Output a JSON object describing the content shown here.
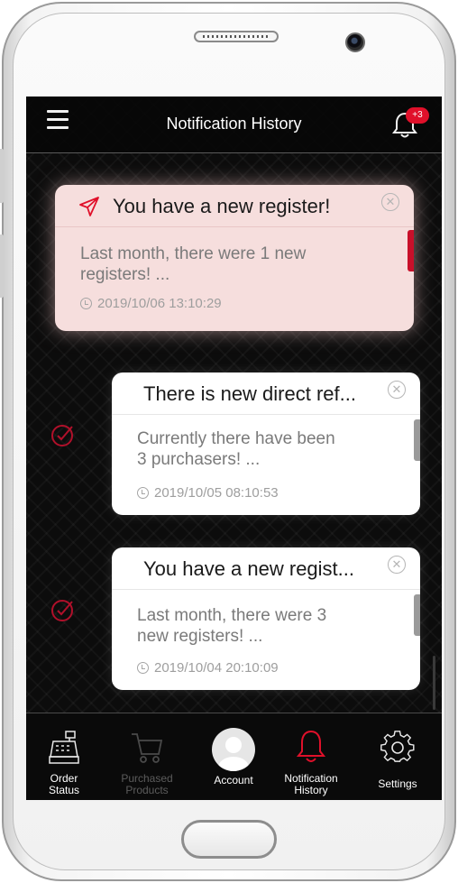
{
  "app": {
    "title": "Notification History",
    "badge_count": "+3",
    "accent_color": "#e0102a"
  },
  "notifications": [
    {
      "title": "You have a new register!",
      "body_line1": "Last month, there were 1 new",
      "body_line2": "registers! ...",
      "time": "2019/10/06 13:10:29",
      "read": false
    },
    {
      "title": "There is new direct ref...",
      "body_line1": "Currently there have been",
      "body_line2": "3 purchasers! ...",
      "time": "2019/10/05 08:10:53",
      "read": true
    },
    {
      "title": "You have a new regist...",
      "body_line1": "Last month, there were 3",
      "body_line2": "new registers! ...",
      "time": "2019/10/04 20:10:09",
      "read": true
    }
  ],
  "nav": {
    "order_status": "Order\nStatus",
    "purchased_products": "Purchased\nProducts",
    "account": "Account",
    "notification_history": "Notification\nHistory",
    "settings": "Settings"
  }
}
